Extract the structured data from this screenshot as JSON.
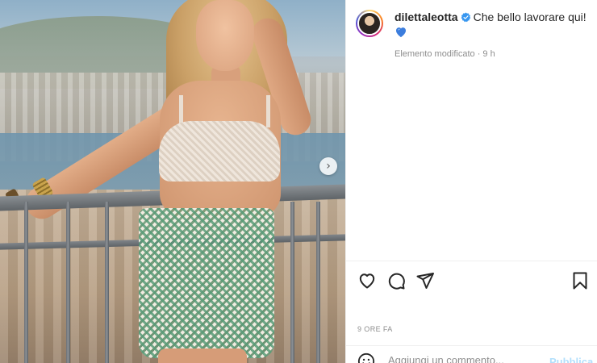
{
  "post": {
    "username": "dilettaleotta",
    "caption": "Che bello lavorare qui!",
    "meta": "Elemento modificato · 9 h",
    "time_label": "9 ORE FA"
  },
  "comment_box": {
    "placeholder": "Aggiungi un commento...",
    "publish_label": "Pubblica"
  },
  "icons": {
    "verified": "verified-badge-icon",
    "caption_emoji": "blue-heart-icon",
    "like": "heart-outline-icon",
    "comment": "speech-bubble-icon",
    "share": "paper-plane-icon",
    "save": "bookmark-icon",
    "emoji": "smiley-icon",
    "carousel_next": "chevron-right-icon"
  },
  "colors": {
    "verified": "#3897f0",
    "heart_emoji": "#3b7ddd",
    "publish": "#b2dffc",
    "text": "#262626",
    "secondary_text": "#8e8e8e"
  }
}
